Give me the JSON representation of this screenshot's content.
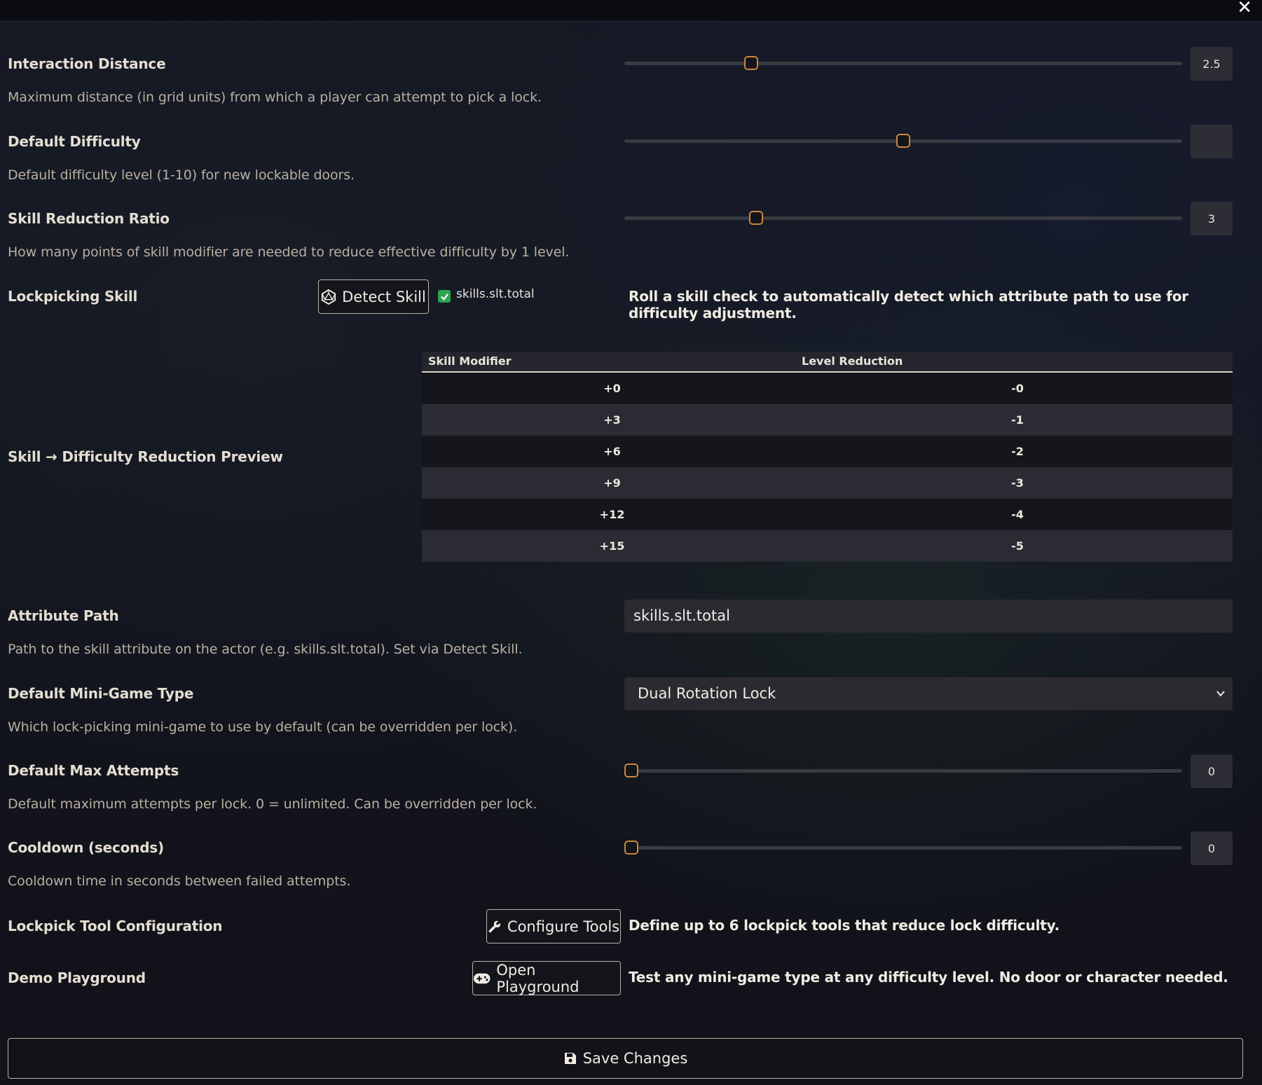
{
  "window": {
    "close_glyph": "✕"
  },
  "settings": {
    "interaction_distance": {
      "label": "Interaction Distance",
      "hint": "Maximum distance (in grid units) from which a player can attempt to pick a lock.",
      "value": "2.5",
      "slider_fraction": 0.22
    },
    "default_difficulty": {
      "label": "Default Difficulty",
      "hint": "Default difficulty level (1-10) for new lockable doors.",
      "value": "",
      "slider_fraction": 0.5
    },
    "skill_reduction_ratio": {
      "label": "Skill Reduction Ratio",
      "hint": "How many points of skill modifier are needed to reduce effective difficulty by 1 level.",
      "value": "3",
      "slider_fraction": 0.23
    },
    "lockpicking_skill": {
      "label": "Lockpicking Skill",
      "detect_button": "Detect Skill",
      "detected_path": "skills.slt.total",
      "detected_checked": true,
      "description": "Roll a skill check to automatically detect which attribute path to use for difficulty adjustment."
    },
    "reduction_preview": {
      "label": "Skill → Difficulty Reduction Preview",
      "columns": [
        "Skill Modifier",
        "Level Reduction"
      ],
      "rows": [
        [
          "+0",
          "-0"
        ],
        [
          "+3",
          "-1"
        ],
        [
          "+6",
          "-2"
        ],
        [
          "+9",
          "-3"
        ],
        [
          "+12",
          "-4"
        ],
        [
          "+15",
          "-5"
        ]
      ]
    },
    "attribute_path": {
      "label": "Attribute Path",
      "hint": "Path to the skill attribute on the actor (e.g. skills.slt.total). Set via Detect Skill.",
      "value": "skills.slt.total"
    },
    "mini_game_type": {
      "label": "Default Mini-Game Type",
      "hint": "Which lock-picking mini-game to use by default (can be overridden per lock).",
      "selected": "Dual Rotation Lock"
    },
    "max_attempts": {
      "label": "Default Max Attempts",
      "hint": "Default maximum attempts per lock. 0 = unlimited. Can be overridden per lock.",
      "value": "0",
      "slider_fraction": 0
    },
    "cooldown": {
      "label": "Cooldown (seconds)",
      "hint": "Cooldown time in seconds between failed attempts.",
      "value": "0",
      "slider_fraction": 0
    },
    "lockpick_tools": {
      "label": "Lockpick Tool Configuration",
      "button": "Configure Tools",
      "description": "Define up to 6 lockpick tools that reduce lock difficulty."
    },
    "demo_playground": {
      "label": "Demo Playground",
      "button": "Open Playground",
      "description": "Test any mini-game type at any difficulty level. No door or character needed."
    }
  },
  "footer": {
    "save_label": "Save Changes"
  },
  "icons": {
    "close": "close-icon",
    "detect": "d20-icon",
    "check": "checkmark-icon",
    "wrench": "wrench-icon",
    "gamepad": "gamepad-icon",
    "save": "floppy-disk-icon",
    "chevron": "chevron-down-icon"
  },
  "colors": {
    "accent_thumb": "#c9893c",
    "checkbox": "#2ea44f",
    "background": "#12131c"
  }
}
